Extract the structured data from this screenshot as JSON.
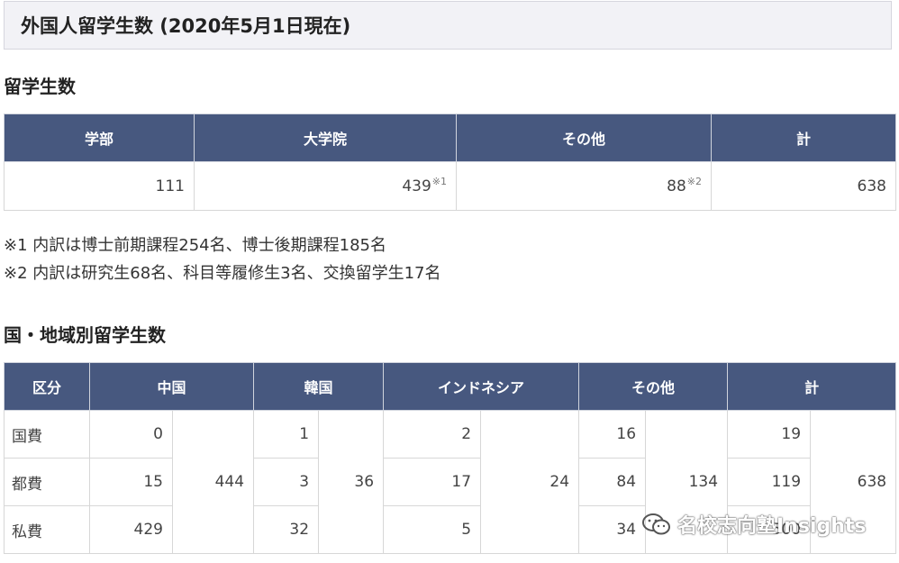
{
  "title": "外国人留学生数 (2020年5月1日現在)",
  "section1": {
    "heading": "留学生数",
    "headers": [
      "学部",
      "大学院",
      "その他",
      "計"
    ],
    "row": [
      {
        "value": "111",
        "note": ""
      },
      {
        "value": "439",
        "note": "※1"
      },
      {
        "value": "88",
        "note": "※2"
      },
      {
        "value": "638",
        "note": ""
      }
    ],
    "notes": [
      "※1 内訳は博士前期課程254名、博士後期課程185名",
      "※2 内訳は研究生68名、科目等履修生3名、交換留学生17名"
    ]
  },
  "section2": {
    "heading": "国・地域別留学生数",
    "headers": {
      "category": "区分",
      "china": "中国",
      "korea": "韓国",
      "indonesia": "インドネシア",
      "other": "その他",
      "total": "計"
    },
    "rows": [
      {
        "label": "国費",
        "china": "0",
        "korea": "1",
        "indonesia": "2",
        "other": "16",
        "total": "19"
      },
      {
        "label": "都費",
        "china": "15",
        "korea": "3",
        "indonesia": "17",
        "other": "84",
        "total": "119"
      },
      {
        "label": "私費",
        "china": "429",
        "korea": "32",
        "indonesia": "5",
        "other": "34",
        "total": "500"
      }
    ],
    "subtotals": {
      "china": "444",
      "korea": "36",
      "indonesia": "24",
      "other": "134",
      "total": "638"
    }
  },
  "watermark": {
    "text": "名校志向塾Insights",
    "icon": "wechat-icon"
  }
}
